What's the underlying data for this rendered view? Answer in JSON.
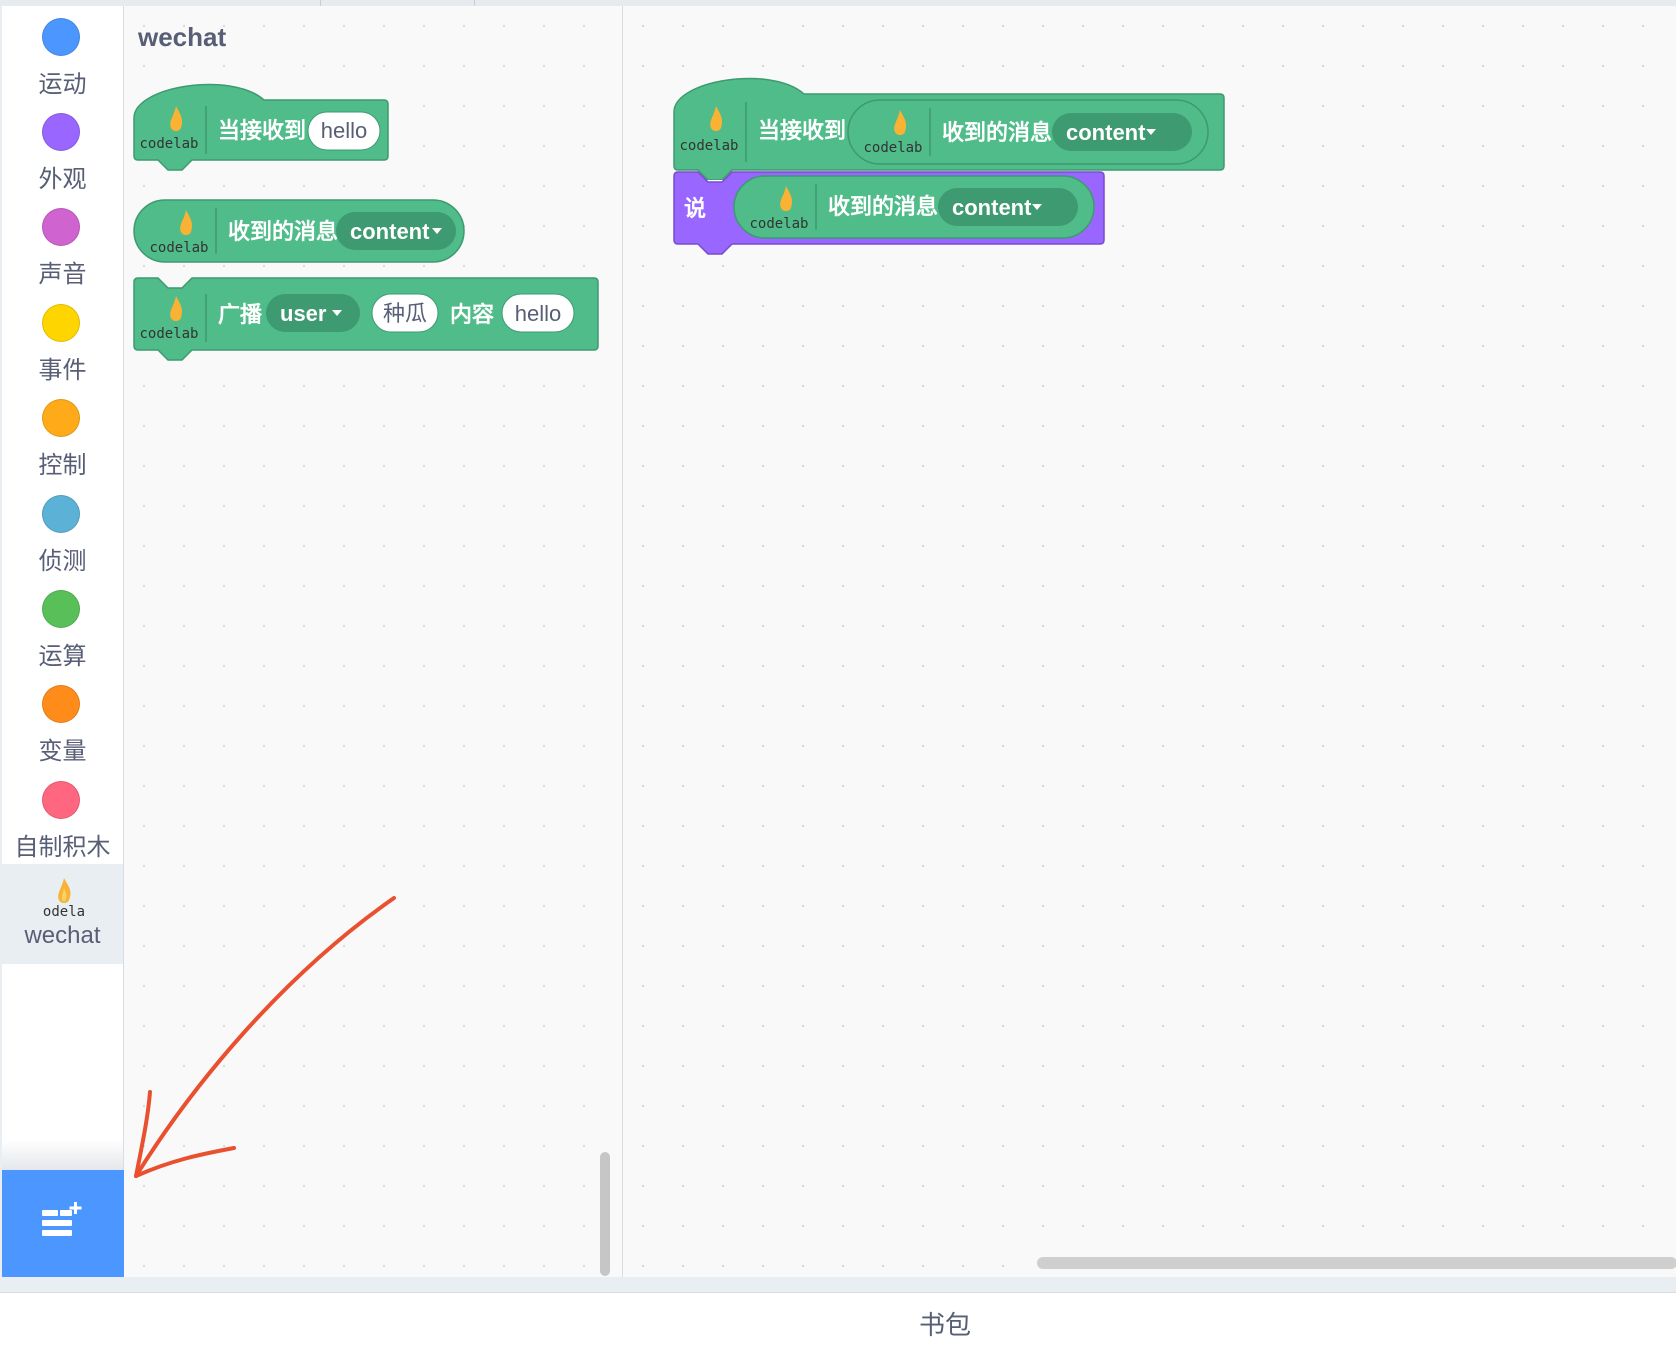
{
  "categories": [
    {
      "label": "运动",
      "color": "#4c97ff",
      "icon": "motion-dot"
    },
    {
      "label": "外观",
      "color": "#9966ff",
      "icon": "looks-dot"
    },
    {
      "label": "声音",
      "color": "#cf63cf",
      "icon": "sound-dot"
    },
    {
      "label": "事件",
      "color": "#ffd500",
      "icon": "events-dot"
    },
    {
      "label": "控制",
      "color": "#ffab19",
      "icon": "control-dot"
    },
    {
      "label": "侦测",
      "color": "#5cb1d6",
      "icon": "sensing-dot"
    },
    {
      "label": "运算",
      "color": "#59c059",
      "icon": "operators-dot"
    },
    {
      "label": "变量",
      "color": "#ff8c1a",
      "icon": "variables-dot"
    },
    {
      "label": "自制积木",
      "color": "#ff6680",
      "icon": "myblocks-dot"
    }
  ],
  "extension": {
    "label": "wechat",
    "logo_text": "codelab",
    "selected": true
  },
  "palette": {
    "title": "wechat",
    "hat_block": {
      "label": "当接收到",
      "input": "hello"
    },
    "reporter_block": {
      "label": "收到的消息",
      "dropdown": "content"
    },
    "broadcast_block": {
      "label": "广播",
      "dropdown": "user",
      "input1": "种瓜",
      "label2": "内容",
      "input2": "hello"
    }
  },
  "workspace": {
    "hat_block": {
      "label": "当接收到",
      "reporter_label": "收到的消息",
      "dropdown": "content"
    },
    "say_block": {
      "label": "说",
      "reporter_label": "收到的消息",
      "dropdown": "content"
    }
  },
  "backpack": {
    "label": "书包"
  },
  "colors": {
    "extension_green": "#4fbc8a",
    "extension_dark": "#3e9a70",
    "looks_purple": "#9966ff",
    "looks_dark": "#774dcb",
    "annotation_arrow": "#e8502f",
    "add_extension_blue": "#4c97ff"
  }
}
